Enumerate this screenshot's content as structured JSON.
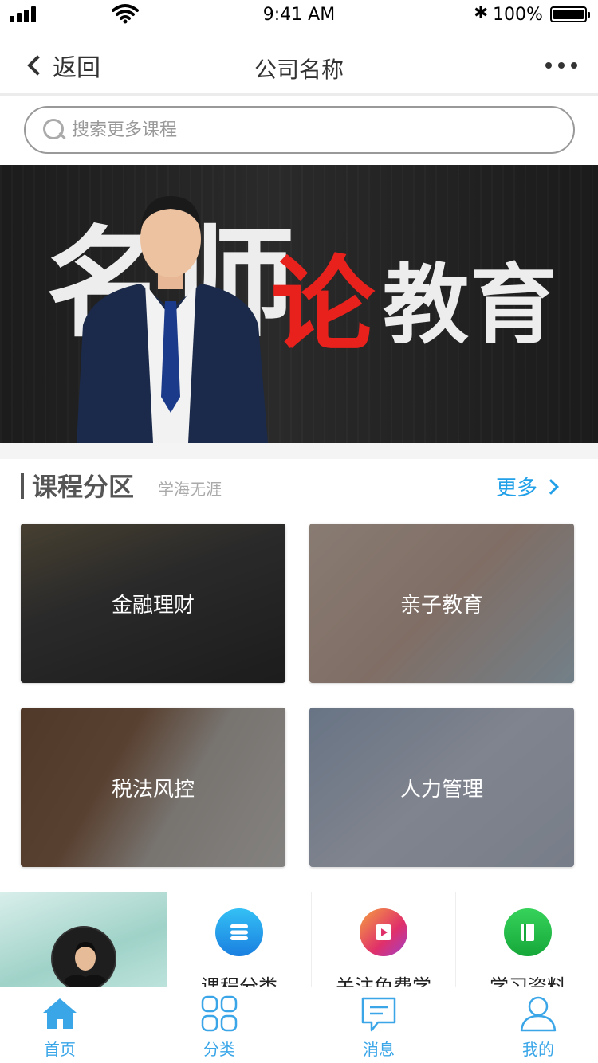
{
  "status_bar": {
    "time": "9:41 AM",
    "battery": "100%"
  },
  "nav": {
    "back_label": "返回",
    "title": "公司名称"
  },
  "search": {
    "placeholder": "搜索更多课程"
  },
  "banner": {
    "chars": [
      "名",
      "师",
      "论",
      "教",
      "育"
    ]
  },
  "section": {
    "title": "课程分区",
    "subtitle": "学海无涯",
    "more": "更多"
  },
  "categories": [
    {
      "label": "金融理财"
    },
    {
      "label": "亲子教育"
    },
    {
      "label": "税法风控"
    },
    {
      "label": "人力管理"
    }
  ],
  "features": [
    {
      "label": "课程分类",
      "icon": "stack-icon"
    },
    {
      "label": "关注免费学",
      "icon": "video-icon"
    },
    {
      "label": "学习资料",
      "icon": "book-icon"
    }
  ],
  "tabs": [
    {
      "label": "首页",
      "icon": "home-icon"
    },
    {
      "label": "分类",
      "icon": "grid-icon"
    },
    {
      "label": "消息",
      "icon": "message-icon"
    },
    {
      "label": "我的",
      "icon": "user-icon"
    }
  ],
  "colors": {
    "accent": "#3aa6e8",
    "more_link": "#22a0e8",
    "banner_highlight": "#e8211c"
  }
}
